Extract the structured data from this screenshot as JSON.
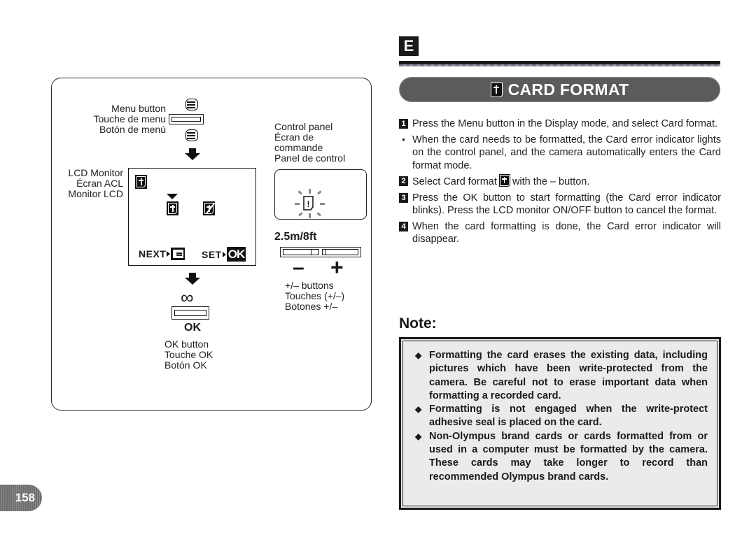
{
  "section_badge": "E",
  "title": "CARD FORMAT",
  "diagram": {
    "menu_button_labels": [
      "Menu button",
      "Touche de menu",
      "Botón de menú"
    ],
    "lcd_monitor_labels": [
      "LCD Monitor",
      "Écran ACL",
      "Monitor LCD"
    ],
    "control_panel_labels": [
      "Control panel",
      "Écran de",
      "commande",
      "Panel de control"
    ],
    "lcd_footer": {
      "next": "NEXT",
      "set": "SET",
      "ok": "OK"
    },
    "distance": "2.5m/8ft",
    "minus": "–",
    "plus": "+",
    "pm_labels": [
      "+/– buttons",
      "Touches (+/–)",
      "Botones +/–"
    ],
    "infinity": "∞",
    "ok_symbol": "OK",
    "ok_labels": [
      "OK button",
      "Touche OK",
      "Botón OK"
    ],
    "error_indicator": "!"
  },
  "steps": [
    {
      "num": "1",
      "text": "Press the Menu button in the Display mode, and select Card format."
    },
    {
      "num": "•",
      "text": "When the card needs to be formatted, the Card error indicator lights on the control panel, and the camera automatically enters the Card format mode."
    },
    {
      "num": "2",
      "text_before": "Select Card format",
      "text_after": "with the – button."
    },
    {
      "num": "3",
      "text": "Press the OK button to start formatting (the Card error indicator blinks). Press the LCD monitor ON/OFF button to cancel the format."
    },
    {
      "num": "4",
      "text": "When the card formatting is done, the Card error indicator will disappear."
    }
  ],
  "note": {
    "heading": "Note:",
    "items": [
      "Formatting the card erases the existing data, including pictures which have been write-protected from the camera. Be careful not to erase important data when formatting a recorded card.",
      "Formatting is not engaged when the write-protect adhesive seal is placed on the card.",
      "Non-Olympus brand cards or cards formatted from or used in a computer must be formatted by the camera. These cards may take longer to record than recommended Olympus brand cards."
    ]
  },
  "page_number": "158"
}
